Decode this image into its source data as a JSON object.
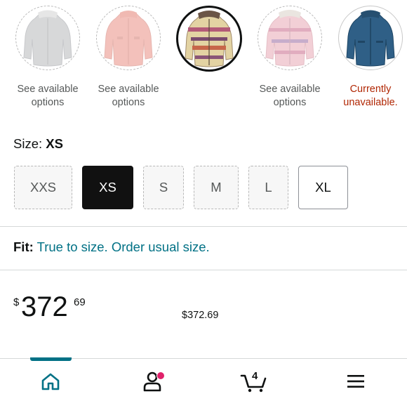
{
  "swatches": [
    {
      "caption": "See available\noptions",
      "state": "available"
    },
    {
      "caption": "See available\noptions",
      "state": "available"
    },
    {
      "caption": "$372.69",
      "state": "selected"
    },
    {
      "caption": "See available\noptions",
      "state": "available"
    },
    {
      "caption": "Currently\nunavailable.",
      "state": "unavailable"
    }
  ],
  "size": {
    "label": "Size:",
    "value": "XS",
    "options": [
      "XXS",
      "XS",
      "S",
      "M",
      "L",
      "XL"
    ]
  },
  "fit": {
    "label": "Fit:",
    "text": "True to size. Order usual size."
  },
  "price": {
    "symbol": "$",
    "whole": "372",
    "fraction": "69"
  },
  "nav": {
    "cart_count": "4",
    "icons": [
      "home-icon",
      "account-icon",
      "cart-icon",
      "menu-icon"
    ]
  },
  "colors": {
    "accent": "#007185",
    "price_unavailable": "#b12704",
    "badge": "#e0216a",
    "selected_size_bg": "#111111"
  }
}
